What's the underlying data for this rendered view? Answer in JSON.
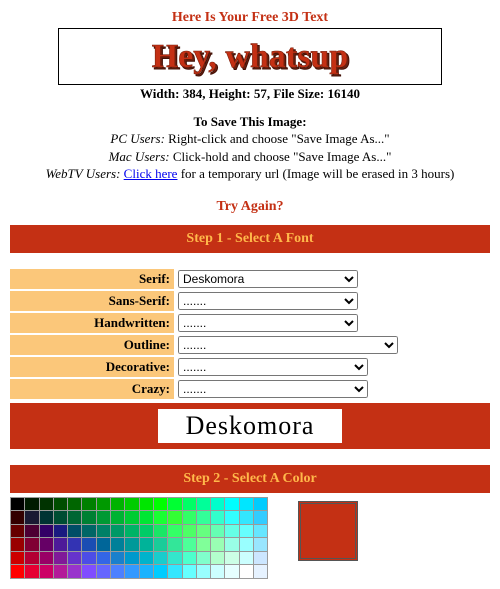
{
  "header": {
    "title": "Here Is Your Free 3D Text",
    "preview_text": "Hey, whatsup",
    "dims": "Width: 384, Height: 57, File Size: 16140"
  },
  "save": {
    "heading": "To Save This Image:",
    "pc_label": "PC Users:",
    "pc_tail": " Right-click and choose \"Save Image As...\"",
    "mac_label": "Mac Users:",
    "mac_tail": " Click-hold and choose \"Save Image As...\"",
    "webtv_label": "WebTV Users:",
    "webtv_link": "Click here",
    "webtv_tail": " for a temporary url (Image will be erased in 3 hours)"
  },
  "try_again": "Try Again?",
  "step1": {
    "title": "Step 1 - Select A Font",
    "rows": [
      {
        "label": "Serif:",
        "value": "Deskomora"
      },
      {
        "label": "Sans-Serif:",
        "value": "......."
      },
      {
        "label": "Handwritten:",
        "value": "......."
      },
      {
        "label": "Outline:",
        "value": "......."
      },
      {
        "label": "Decorative:",
        "value": "......."
      },
      {
        "label": "Crazy:",
        "value": "......."
      }
    ],
    "preview_name": "Deskomora"
  },
  "step2": {
    "title": "Step 2 - Select A Color",
    "selected_color": "#c43014",
    "palette": [
      "#000000",
      "#001a00",
      "#003300",
      "#004d00",
      "#006600",
      "#008000",
      "#009900",
      "#00b300",
      "#00cc00",
      "#00e600",
      "#00ff00",
      "#00ff33",
      "#00ff66",
      "#00ff99",
      "#00ffcc",
      "#00ffff",
      "#00e6ff",
      "#00ccff",
      "#330000",
      "#1a1a33",
      "#003333",
      "#004d33",
      "#006633",
      "#008033",
      "#009933",
      "#00b333",
      "#00cc33",
      "#00e633",
      "#1aff33",
      "#33ff33",
      "#33ff66",
      "#33ff99",
      "#33ffcc",
      "#33ffff",
      "#33e6ff",
      "#33ccff",
      "#660000",
      "#4d0033",
      "#330066",
      "#1a1a80",
      "#004d66",
      "#006666",
      "#008066",
      "#009966",
      "#00b366",
      "#00cc66",
      "#1ae666",
      "#33ff66",
      "#4dff66",
      "#66ff80",
      "#66ffb3",
      "#66ffe6",
      "#66ffff",
      "#66e6ff",
      "#990000",
      "#800033",
      "#660066",
      "#4d1a99",
      "#3333b3",
      "#1a4db3",
      "#006699",
      "#008099",
      "#009999",
      "#00b399",
      "#1acc99",
      "#33e699",
      "#4dff99",
      "#80ff99",
      "#99ffb3",
      "#99ffe6",
      "#99ffff",
      "#99e6ff",
      "#cc0000",
      "#b30033",
      "#990066",
      "#801a99",
      "#6633cc",
      "#4d4de6",
      "#3366e6",
      "#1a80cc",
      "#0099cc",
      "#00b3cc",
      "#1acccc",
      "#33e6cc",
      "#4dffcc",
      "#80ffcc",
      "#b3ffcc",
      "#ccffe6",
      "#ccffff",
      "#cce6ff",
      "#ff0000",
      "#e60033",
      "#cc0066",
      "#b31a99",
      "#9933cc",
      "#804dff",
      "#6666ff",
      "#4d80ff",
      "#3399ff",
      "#1ab3ff",
      "#00ccff",
      "#33e6ff",
      "#66ffff",
      "#99ffff",
      "#ccffff",
      "#e6ffff",
      "#ffffff",
      "#e6f2ff"
    ]
  }
}
